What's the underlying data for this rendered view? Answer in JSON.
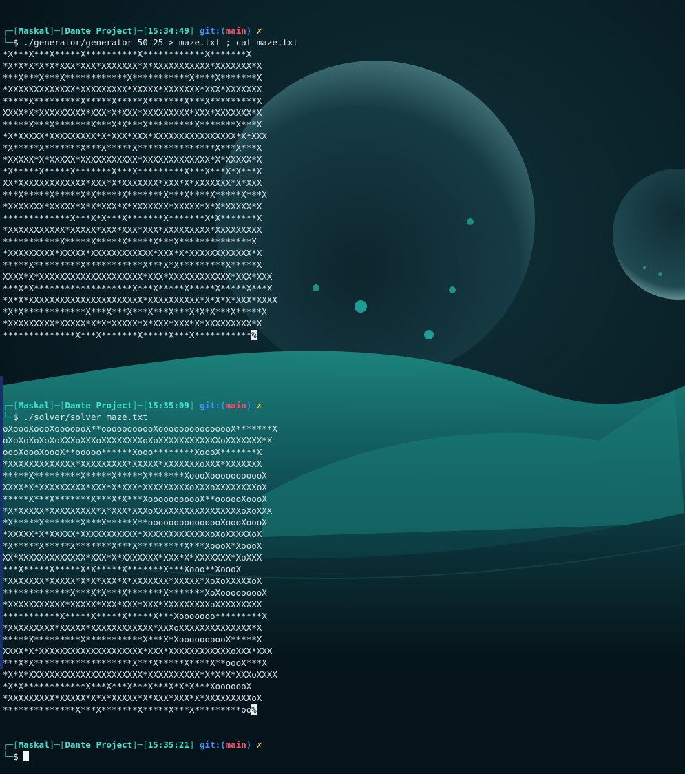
{
  "colors": {
    "prompt": "#1ec8b0",
    "git": "#3f8fff",
    "branch": "#ff4f6b",
    "mark": "#f1d547"
  },
  "prompts": [
    {
      "user": "Maskal",
      "dir": "Dante Project",
      "time": "15:34:49",
      "git": "git:",
      "branch": "main",
      "mark": "✗",
      "command": "./generator/generator 50 25 > maze.txt ; cat maze.txt"
    },
    {
      "user": "Maskal",
      "dir": "Dante Project",
      "time": "15:35:09",
      "git": "git:",
      "branch": "main",
      "mark": "✗",
      "command": "./solver/solver maze.txt"
    },
    {
      "user": "Maskal",
      "dir": "Dante Project",
      "time": "15:35:21",
      "git": "git:",
      "branch": "main",
      "mark": "✗",
      "command": ""
    }
  ],
  "maze": [
    "*X***X***X*****X**********X************X*******X",
    "*X*X*X*X*X*XXX*XXX*XXXXXXX*X*XXXXXXXXXXX*XXXXXXX*X",
    "***X***X***X************X***********X****X*******X",
    "*XXXXXXXXXXXXX*XXXXXXXXX*XXXXX*XXXXXXX*XXX*XXXXXXX",
    "*****X*********X*****X*****X*******X***X*********X",
    "XXXX*X*XXXXXXXXX*XXX*X*XXX*XXXXXXXXX*XXX*XXXXXXX*X",
    "*****X***X*******X***X*X***X*********X*******X***X",
    "*X*XXXXX*XXXXXXXXX*X*XXX*XXX*XXXXXXXXXXXXXXXX*X*XXX",
    "*X*****X*******X***X*****X***************X***X***X",
    "*XXXXX*X*XXXXX*XXXXXXXXXXX*XXXXXXXXXXXXX*X*XXXXX*X",
    "*X*****X*****X*******X***X*********X***X***X*X***X",
    "XX*XXXXXXXXXXXXX*XXX*X*XXXXXXX*XXX*X*XXXXXXX*X*XXX",
    "***X*****X*****X*X*****X*******X***X****X*****X***X",
    "*XXXXXXX*XXXXX*X*X*XXX*X*XXXXXXX*XXXXX*X*X*XXXXX*X",
    "*************X***X*X***X*******X*******X*X*******X",
    "*XXXXXXXXXXX*XXXXX*XXX*XXX*XXX*XXXXXXXXX*XXXXXXXXX",
    "***********X*****X*****X*****X***X**************X",
    "*XXXXXXXXX*XXXXX*XXXXXXXXXXXX*XXX*X*XXXXXXXXXXXX*X",
    "*****X*********X***********X***X*X*********X*****X",
    "XXXX*X*XXXXXXXXXXXXXXXXXXXX*XXX*XXXXXXXXXXXX*XXX*XXX",
    "***X*X*******************X***X*****X*****X*****X***X",
    "*X*X*XXXXXXXXXXXXXXXXXXXXXX*XXXXXXXXXX*X*X*X*XXX*XXXX",
    "*X*X************X***X***X***X***X***X*X*X***X*****X",
    "*XXXXXXXXX*XXXXX*X*X*XXXXX*X*XXX*XXX*X*XXXXXXXXX*X",
    "**************X***X*******X*****X***X***********%"
  ],
  "solution": [
    "oXoooXoooXooooooX**ooooooooooXooooooooooooooX*******X",
    "oXoXoXoXoXoXXXoXXXoXXXXXXXXoXoXXXXXXXXXXXXoXXXXXXX*X",
    "oooXoooXoooX**ooooo******Xooo********XoooX*******X",
    "*XXXXXXXXXXXXX*XXXXXXXXX*XXXXX*XXXXXXXoXXX*XXXXXXX",
    "*****X*********X*****X*****X*******XoooXooooooooooX",
    "XXXX*X*XXXXXXXXX*XXX*X*XXX*XXXXXXXXXoXXXoXXXXXXXXoX",
    "*****X***X*******X***X*X***XooooooooooX**oooooXoooX",
    "*X*XXXXX*XXXXXXXXX*X*XXX*XXXoXXXXXXXXXXXXXXXXXoXoXXX",
    "*X*****X*******X***X*****X**ooooooooooooooXoooXoooX",
    "*XXXXX*X*XXXXX*XXXXXXXXXXX*XXXXXXXXXXXXXoXoXXXXXoX",
    "*X*****X*****X*******X***X*********X***XoooX*XoooX",
    "XX*XXXXXXXXXXXXX*XXX*X*XXXXXXX*XXX*X*XXXXXXX*XoXXX",
    "***X*****X*****X*X*****X*******X***Xooo**XoooX",
    "*XXXXXXX*XXXXX*X*X*XXX*X*XXXXXXX*XXXXX*XoXoXXXXXoX",
    "*************X***X*X***X*******X*******XoXooooooooX",
    "*XXXXXXXXXXX*XXXXX*XXX*XXX*XXX*XXXXXXXXXoXXXXXXXXX",
    "***********X*****X*****X*****X***Xooooooo*********X",
    "*XXXXXXXXX*XXXXX*XXXXXXXXXXXX*XXXoXXXXXXXXXXXXXX*X",
    "*****X*********X***********X***X*XoooooooooX*****X",
    "XXXX*X*XXXXXXXXXXXXXXXXXXXX*XXX*XXXXXXXXXXXXoXXX*XXX",
    "***X*X*******************X***X*****X****X**oooX***X",
    "*X*X*XXXXXXXXXXXXXXXXXXXXXX*XXXXXXXXXX*X*X*X*XXXoXXXX",
    "*X*X************X***X***X***X***X*X*X***XooooooX",
    "*XXXXXXXXX*XXXXX*X*X*XXXXX*X*XXX*XXX*X*XXXXXXXXXoX",
    "**************X***X*******X*****X***X*********oo%"
  ]
}
